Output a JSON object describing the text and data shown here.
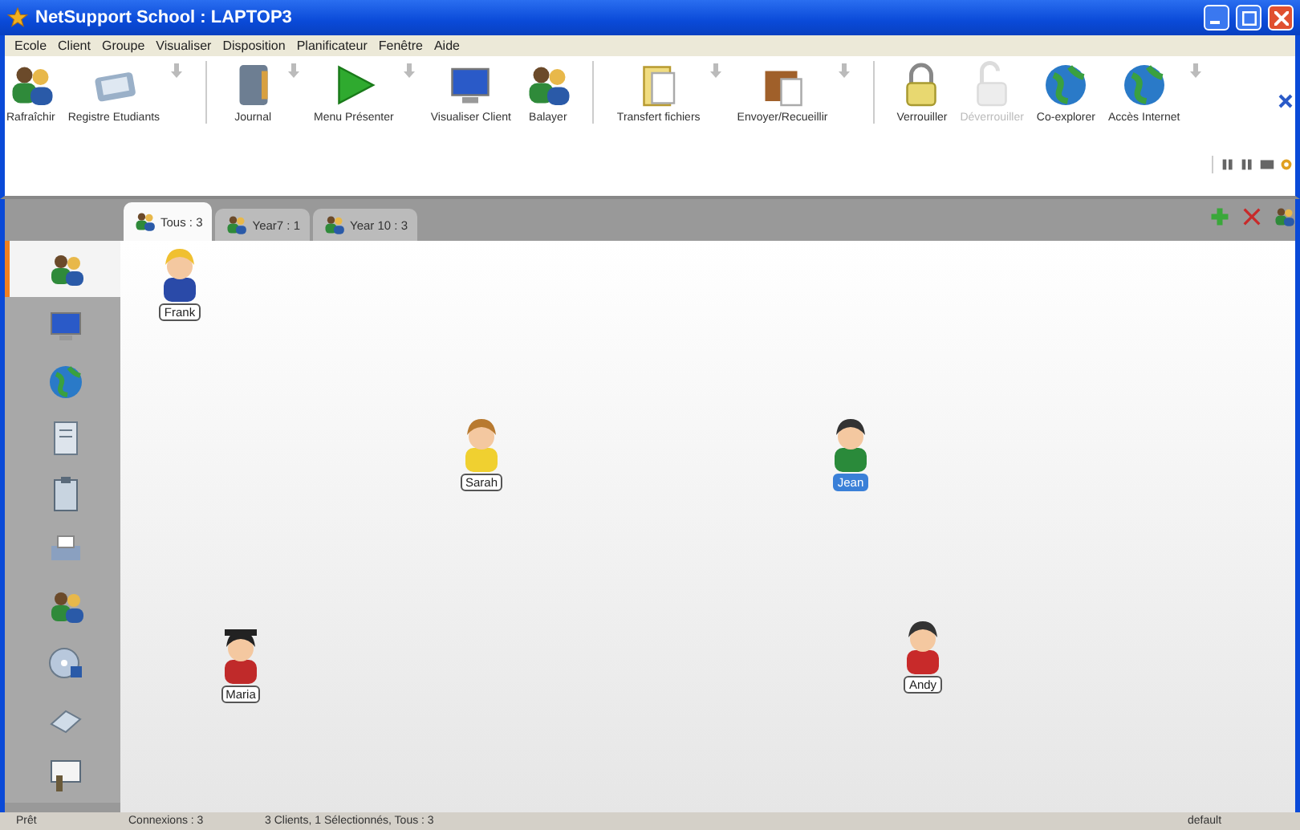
{
  "window": {
    "title": "NetSupport School : LAPTOP3"
  },
  "menu": [
    "Ecole",
    "Client",
    "Groupe",
    "Visualiser",
    "Disposition",
    "Planificateur",
    "Fenêtre",
    "Aide"
  ],
  "toolbar": [
    {
      "label": "Rafraîchir",
      "kind": "people",
      "dropdown": false,
      "disabled": false,
      "separator_before": false
    },
    {
      "label": "Registre Etudiants",
      "kind": "register",
      "dropdown": true,
      "disabled": false,
      "separator_before": false
    },
    {
      "label": "Journal",
      "kind": "journal",
      "dropdown": true,
      "disabled": false,
      "separator_before": true
    },
    {
      "label": "Menu Présenter",
      "kind": "play",
      "dropdown": true,
      "disabled": false,
      "separator_before": false
    },
    {
      "label": "Visualiser Client",
      "kind": "monitor",
      "dropdown": false,
      "disabled": false,
      "separator_before": false
    },
    {
      "label": "Balayer",
      "kind": "people",
      "dropdown": false,
      "disabled": false,
      "separator_before": false
    },
    {
      "label": "Transfert fichiers",
      "kind": "folder",
      "dropdown": true,
      "disabled": false,
      "separator_before": true
    },
    {
      "label": "Envoyer/Recueillir",
      "kind": "box",
      "dropdown": true,
      "disabled": false,
      "separator_before": false
    },
    {
      "label": "Verrouiller",
      "kind": "lock",
      "dropdown": false,
      "disabled": false,
      "separator_before": true
    },
    {
      "label": "Déverrouiller",
      "kind": "unlock",
      "dropdown": false,
      "disabled": true,
      "separator_before": false
    },
    {
      "label": "Co-explorer",
      "kind": "globe",
      "dropdown": false,
      "disabled": false,
      "separator_before": false
    },
    {
      "label": "Accès Internet",
      "kind": "globe",
      "dropdown": true,
      "disabled": false,
      "separator_before": false
    }
  ],
  "tabs": [
    {
      "label": "Tous : 3",
      "selected": true
    },
    {
      "label": "Year7 : 1",
      "selected": false
    },
    {
      "label": "Year 10 : 3",
      "selected": false
    }
  ],
  "sidebar": [
    {
      "kind": "people",
      "selected": true
    },
    {
      "kind": "monitor",
      "selected": false
    },
    {
      "kind": "globe",
      "selected": false
    },
    {
      "kind": "doc",
      "selected": false
    },
    {
      "kind": "clipboard",
      "selected": false
    },
    {
      "kind": "printer",
      "selected": false
    },
    {
      "kind": "people",
      "selected": false
    },
    {
      "kind": "disc",
      "selected": false
    },
    {
      "kind": "scanner",
      "selected": false
    },
    {
      "kind": "board",
      "selected": false
    }
  ],
  "students": [
    {
      "name": "Frank",
      "kind": "boy",
      "selected": false
    },
    {
      "name": "Sarah",
      "kind": "girl",
      "selected": false
    },
    {
      "name": "Jean",
      "kind": "dark",
      "selected": true
    },
    {
      "name": "Maria",
      "kind": "graduate",
      "selected": false
    },
    {
      "name": "Andy",
      "kind": "red",
      "selected": false
    }
  ],
  "status_bar": [
    "Prêt",
    "Connexions : 3",
    "3 Clients, 1 Sélectionnés, Tous : 3",
    "default"
  ]
}
